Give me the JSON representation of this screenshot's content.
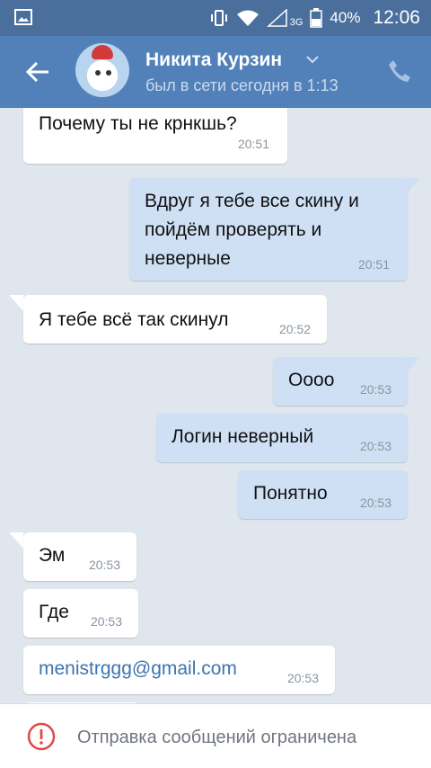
{
  "status_bar": {
    "battery": "40%",
    "time": "12:06",
    "network": "3G"
  },
  "header": {
    "name": "Никита Курзин",
    "last_seen": "был в сети сегодня в 1:13"
  },
  "messages": [
    {
      "text": "Почему ты не крнкшь?",
      "time": "20:51",
      "dir": "in"
    },
    {
      "text_lines": [
        "Вдруг я тебе все скину и",
        "пойдём проверять и",
        "неверные"
      ],
      "time": "20:51",
      "dir": "out"
    },
    {
      "text": "Я тебе всё так скинул",
      "time": "20:52",
      "dir": "in"
    },
    {
      "text": "Оооо",
      "time": "20:53",
      "dir": "out"
    },
    {
      "text": "Логин неверный",
      "time": "20:53",
      "dir": "out"
    },
    {
      "text": "Понятно",
      "time": "20:53",
      "dir": "out"
    },
    {
      "text": "Эм",
      "time": "20:53",
      "dir": "in"
    },
    {
      "text": "Где",
      "time": "20:53",
      "dir": "in"
    },
    {
      "text": "menistrggg@gmail.com",
      "time": "20:53",
      "dir": "in"
    }
  ],
  "footer": {
    "notice": "Отправка сообщений ограничена"
  },
  "colors": {
    "header": "#5181b8",
    "status_bar": "#4a6f9c",
    "outgoing": "#cfe0f5",
    "incoming": "#ffffff",
    "background": "#dfe6ee",
    "warning": "#e64646"
  }
}
